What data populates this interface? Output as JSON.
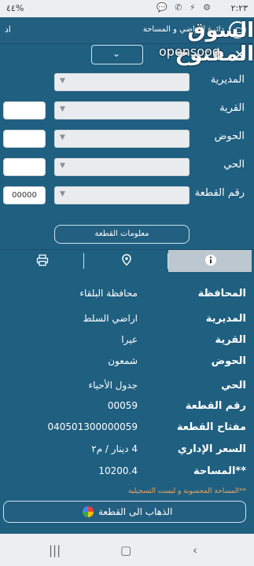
{
  "status_bar": {
    "time": "٢:٢٣",
    "icons": "💬 ✆ ⚡ ⚙",
    "battery": "٤٤%"
  },
  "app_bar": {
    "dept_title": "دائرة الاراضي و المساحة",
    "lang_prefix": "اد"
  },
  "watermark": {
    "arabic": "السوق المفتوح",
    "latin": "opensooq"
  },
  "form": {
    "directorate_label": "المديرية",
    "village_label": "القرية",
    "basin_label": "الحوض",
    "neighborhood_label": "الحي",
    "parcel_label": "رقم القطعة",
    "parcel_box_value": "00000",
    "info_button": "معلومات القطعة"
  },
  "tabs": [
    {
      "name": "info",
      "icon": "info-icon"
    },
    {
      "name": "location",
      "icon": "location-pin-icon"
    },
    {
      "name": "print",
      "icon": "printer-icon"
    }
  ],
  "details": [
    {
      "key": "المحافظة",
      "value": "محافظة البلقاء"
    },
    {
      "key": "المديرية",
      "value": "اراضي السلط"
    },
    {
      "key": "القرية",
      "value": "عيرا"
    },
    {
      "key": "الحوض",
      "value": "شمعون"
    },
    {
      "key": "الحي",
      "value": "جدول الأحياء"
    },
    {
      "key": "رقم القطعة",
      "value": "00059"
    },
    {
      "key": "مفتاح القطعة",
      "value": "040501300000059"
    },
    {
      "key": "السعر الإداري",
      "value": "4 دينار / م٢"
    },
    {
      "key": "**المساحة",
      "value": "10200.4"
    }
  ],
  "note": "**المساحة المحسوبة و ليست التسجيلية",
  "goto_button": "الذهاب الى القطعة",
  "colors": {
    "bg": "#1f5f80",
    "active_tab": "#bcc7cf",
    "note": "#f0a35e"
  }
}
